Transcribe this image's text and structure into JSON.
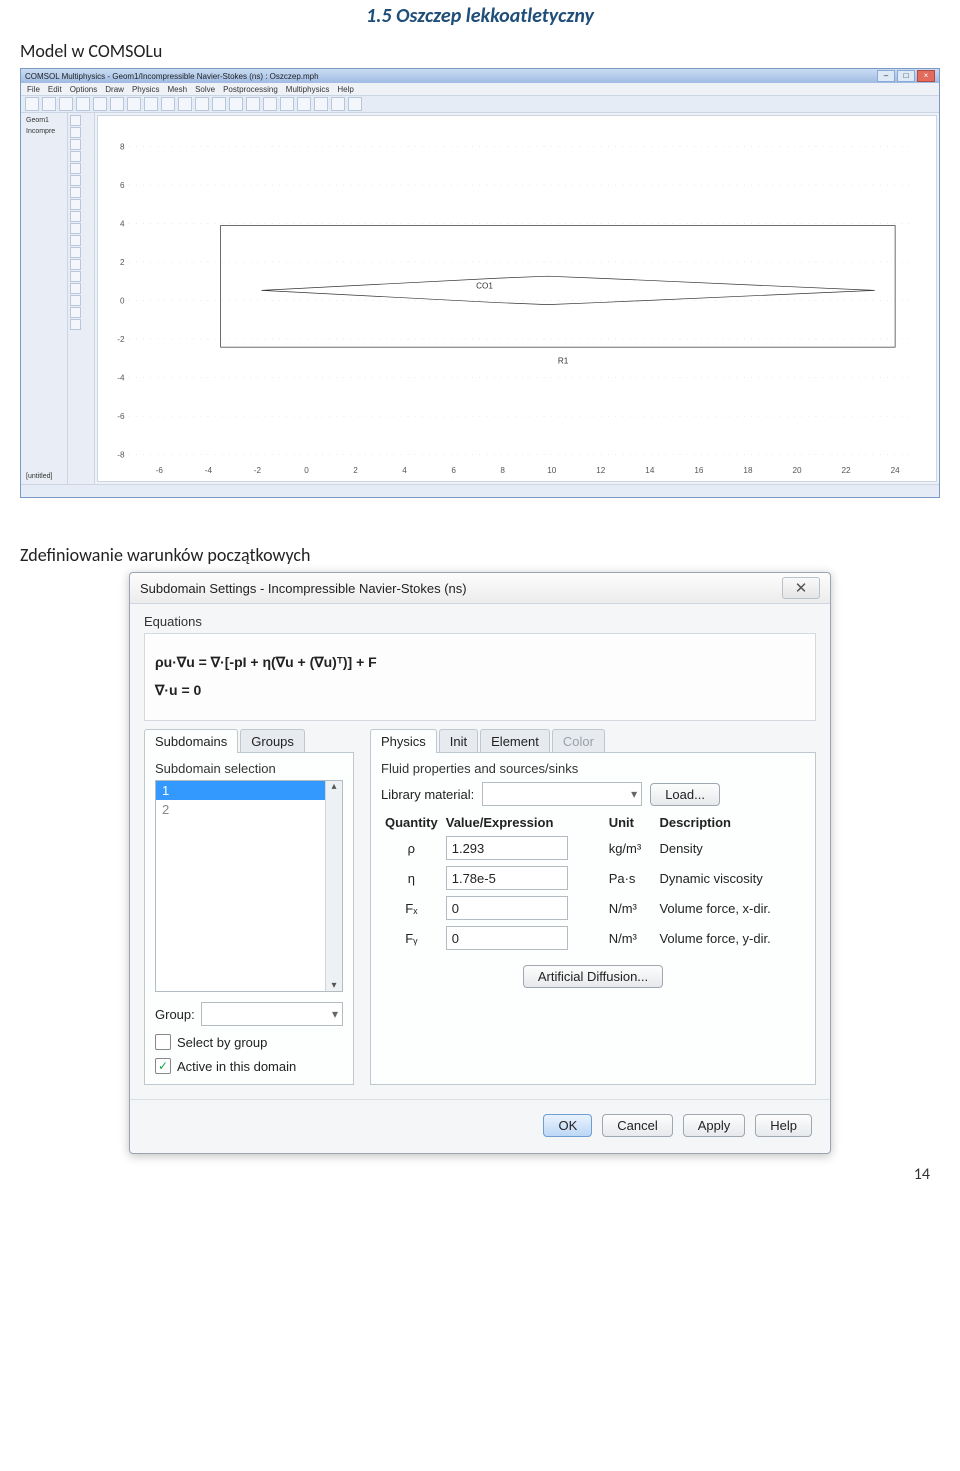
{
  "page": {
    "section_title": "1.5 Oszczep lekkoatletyczny",
    "text_model": "Model w COMSOLu",
    "text_definition": "Zdefiniowanie warunków początkowych",
    "number": "14"
  },
  "comsol": {
    "title": "COMSOL Multiphysics - Geom1/Incompressible Navier-Stokes (ns) : Oszczep.mph",
    "menu": [
      "File",
      "Edit",
      "Options",
      "Draw",
      "Physics",
      "Mesh",
      "Solve",
      "Postprocessing",
      "Multiphysics",
      "Help"
    ],
    "tree": [
      "Geom1",
      "Incompre"
    ],
    "untitled": "[untitled]",
    "labels": {
      "co1": "CO1",
      "r1": "R1"
    },
    "x_ticks": [
      "-6",
      "-4",
      "-2",
      "0",
      "2",
      "4",
      "6",
      "8",
      "10",
      "12",
      "14",
      "16",
      "18",
      "20",
      "22",
      "24"
    ],
    "y_ticks": [
      "8",
      "6",
      "4",
      "2",
      "0",
      "-2",
      "-4",
      "-6",
      "-8"
    ]
  },
  "dialog": {
    "title": "Subdomain Settings - Incompressible Navier-Stokes (ns)",
    "equations_label": "Equations",
    "eq1": "ρu·∇u = ∇·[-pI + η(∇u + (∇u)ᵀ)] + F",
    "eq2": "∇·u = 0",
    "left_tabs": {
      "subdomains": "Subdomains",
      "groups": "Groups"
    },
    "subdomain_selection_label": "Subdomain selection",
    "list_items": [
      "1",
      "2"
    ],
    "group_label": "Group:",
    "select_by_group": "Select by group",
    "active_in_domain": "Active in this domain",
    "right_tabs": {
      "physics": "Physics",
      "init": "Init",
      "element": "Element",
      "color": "Color"
    },
    "fluid_label": "Fluid properties and sources/sinks",
    "library_label": "Library material:",
    "load_btn": "Load...",
    "headers": {
      "qty": "Quantity",
      "val": "Value/Expression",
      "unit": "Unit",
      "desc": "Description"
    },
    "rows": [
      {
        "sym": "ρ",
        "val": "1.293",
        "unit": "kg/m³",
        "desc": "Density"
      },
      {
        "sym": "η",
        "val": "1.78e-5",
        "unit": "Pa·s",
        "desc": "Dynamic viscosity"
      },
      {
        "sym": "Fₓ",
        "val": "0",
        "unit": "N/m³",
        "desc": "Volume force, x-dir."
      },
      {
        "sym": "Fᵧ",
        "val": "0",
        "unit": "N/m³",
        "desc": "Volume force, y-dir."
      }
    ],
    "artificial_btn": "Artificial Diffusion...",
    "buttons": {
      "ok": "OK",
      "cancel": "Cancel",
      "apply": "Apply",
      "help": "Help"
    }
  }
}
